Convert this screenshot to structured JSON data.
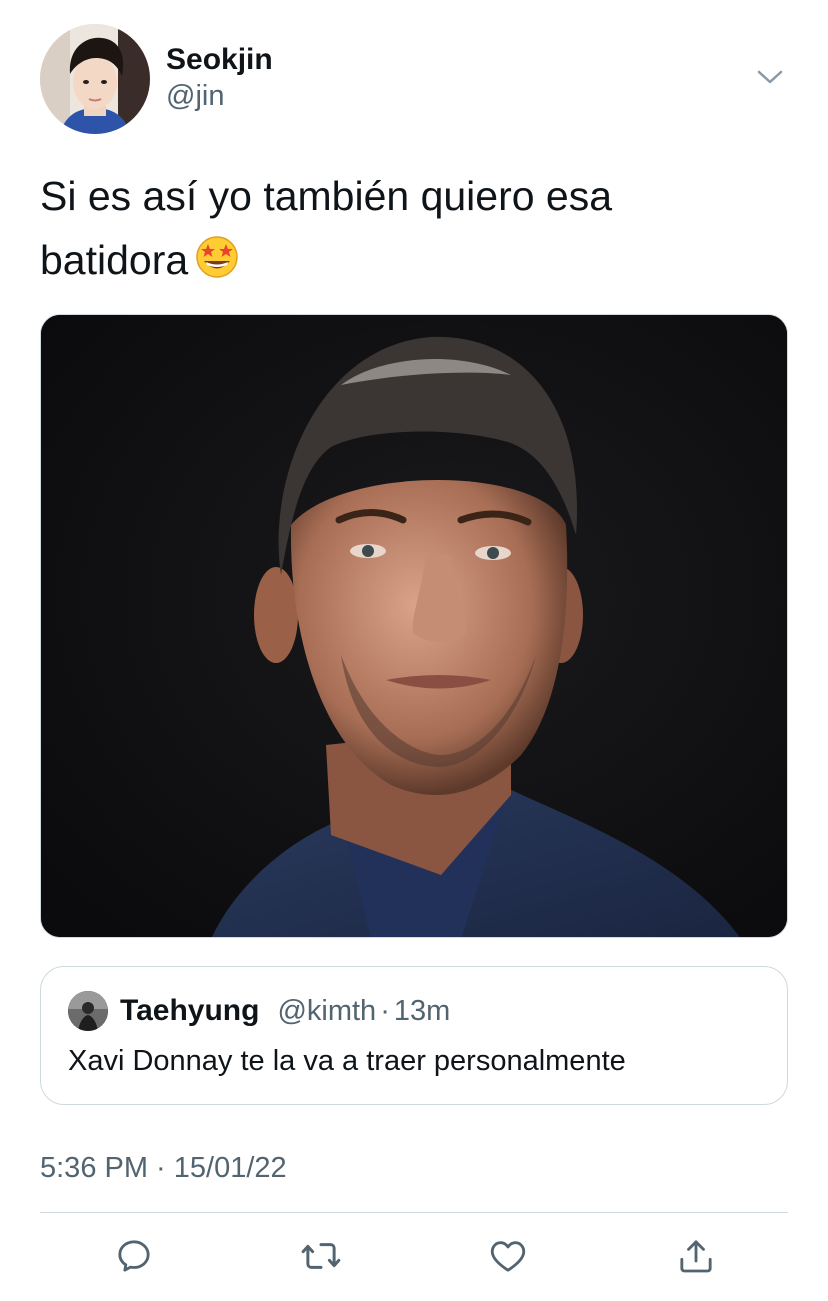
{
  "tweet": {
    "author": {
      "display_name": "Seokjin",
      "handle": "@jin",
      "avatar_icon": "profile-photo"
    },
    "text_line1": "Si es así yo también quiero esa",
    "text_line2": "batidora",
    "emoji": "🤩",
    "media": {
      "type": "photo",
      "background_color": "#0d0d0f"
    },
    "quoted": {
      "display_name": "Taehyung",
      "handle": "@kimth",
      "separator": "·",
      "time": "13m",
      "text": "Xavi Donnay te la va a traer personalmente"
    },
    "timestamp": "5:36 PM · 15/01/22",
    "actions": [
      {
        "name": "reply",
        "icon": "reply-icon"
      },
      {
        "name": "retweet",
        "icon": "retweet-icon"
      },
      {
        "name": "like",
        "icon": "heart-icon"
      },
      {
        "name": "share",
        "icon": "share-icon"
      }
    ],
    "colors": {
      "text_primary": "#0f1419",
      "text_secondary": "#536471",
      "border": "#cfd9de",
      "icon": "#536471"
    }
  }
}
